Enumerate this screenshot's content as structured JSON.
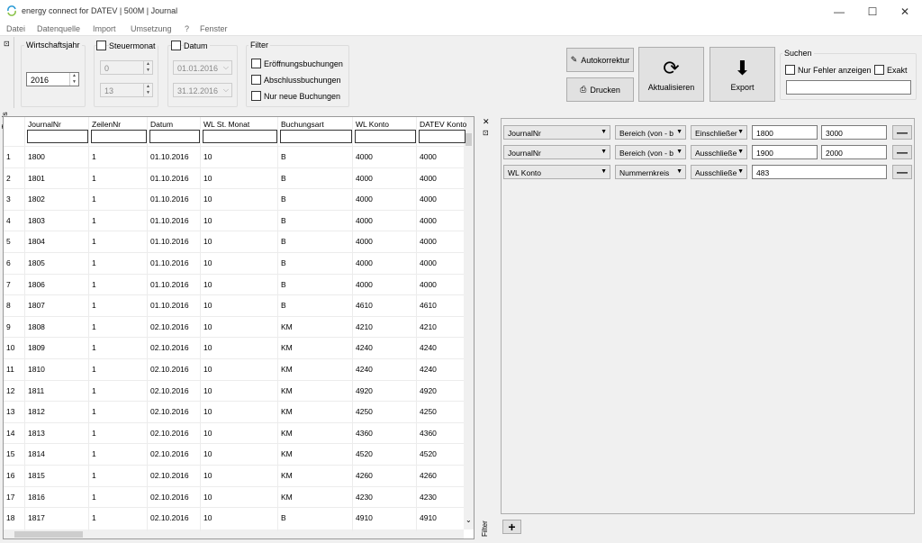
{
  "window": {
    "title": "energy connect for DATEV | 500M | Journal"
  },
  "menu": [
    "Datei",
    "Datenquelle",
    "Import",
    "Umsetzung",
    "?",
    "Fenster"
  ],
  "tools_label": "Tools",
  "filter_label": "Filter",
  "wirtschaftsjahr": {
    "label": "Wirtschaftsjahr",
    "value": "2016"
  },
  "steuermonat": {
    "label": "Steuermonat",
    "from": "0",
    "to": "13"
  },
  "datum": {
    "label": "Datum",
    "from": "01.01.2016",
    "to": "31.12.2016"
  },
  "filter": {
    "label": "Filter",
    "options": [
      "Eröffnungsbuchungen",
      "Abschlussbuchungen",
      "Nur neue Buchungen"
    ]
  },
  "buttons": {
    "autokorrektur": "Autokorrektur",
    "drucken": "Drucken",
    "aktualisieren": "Aktualisieren",
    "export": "Export"
  },
  "suchen": {
    "label": "Suchen",
    "nur_fehler": "Nur Fehler anzeigen",
    "exakt": "Exakt"
  },
  "grid": {
    "columns": [
      "JournalNr",
      "ZeilenNr",
      "Datum",
      "WL St. Monat",
      "Buchungsart",
      "WL Konto",
      "DATEV Konto"
    ],
    "rows": [
      [
        "1",
        "1800",
        "1",
        "01.10.2016",
        "10",
        "B",
        "4000",
        "4000"
      ],
      [
        "2",
        "1801",
        "1",
        "01.10.2016",
        "10",
        "B",
        "4000",
        "4000"
      ],
      [
        "3",
        "1802",
        "1",
        "01.10.2016",
        "10",
        "B",
        "4000",
        "4000"
      ],
      [
        "4",
        "1803",
        "1",
        "01.10.2016",
        "10",
        "B",
        "4000",
        "4000"
      ],
      [
        "5",
        "1804",
        "1",
        "01.10.2016",
        "10",
        "B",
        "4000",
        "4000"
      ],
      [
        "6",
        "1805",
        "1",
        "01.10.2016",
        "10",
        "B",
        "4000",
        "4000"
      ],
      [
        "7",
        "1806",
        "1",
        "01.10.2016",
        "10",
        "B",
        "4000",
        "4000"
      ],
      [
        "8",
        "1807",
        "1",
        "01.10.2016",
        "10",
        "B",
        "4610",
        "4610"
      ],
      [
        "9",
        "1808",
        "1",
        "02.10.2016",
        "10",
        "KM",
        "4210",
        "4210"
      ],
      [
        "10",
        "1809",
        "1",
        "02.10.2016",
        "10",
        "KM",
        "4240",
        "4240"
      ],
      [
        "11",
        "1810",
        "1",
        "02.10.2016",
        "10",
        "KM",
        "4240",
        "4240"
      ],
      [
        "12",
        "1811",
        "1",
        "02.10.2016",
        "10",
        "KM",
        "4920",
        "4920"
      ],
      [
        "13",
        "1812",
        "1",
        "02.10.2016",
        "10",
        "KM",
        "4250",
        "4250"
      ],
      [
        "14",
        "1813",
        "1",
        "02.10.2016",
        "10",
        "KM",
        "4360",
        "4360"
      ],
      [
        "15",
        "1814",
        "1",
        "02.10.2016",
        "10",
        "KM",
        "4520",
        "4520"
      ],
      [
        "16",
        "1815",
        "1",
        "02.10.2016",
        "10",
        "KM",
        "4260",
        "4260"
      ],
      [
        "17",
        "1816",
        "1",
        "02.10.2016",
        "10",
        "KM",
        "4230",
        "4230"
      ],
      [
        "18",
        "1817",
        "1",
        "02.10.2016",
        "10",
        "B",
        "4910",
        "4910"
      ]
    ]
  },
  "filters": [
    {
      "field": "JournalNr",
      "op": "Bereich (von - b",
      "mode": "Einschließer",
      "v1": "1800",
      "v2": "3000"
    },
    {
      "field": "JournalNr",
      "op": "Bereich (von - b",
      "mode": "Ausschließe",
      "v1": "1900",
      "v2": "2000"
    },
    {
      "field": "WL Konto",
      "op": "Nummernkreis",
      "mode": "Ausschließe",
      "v1": "483",
      "v2": null
    }
  ]
}
